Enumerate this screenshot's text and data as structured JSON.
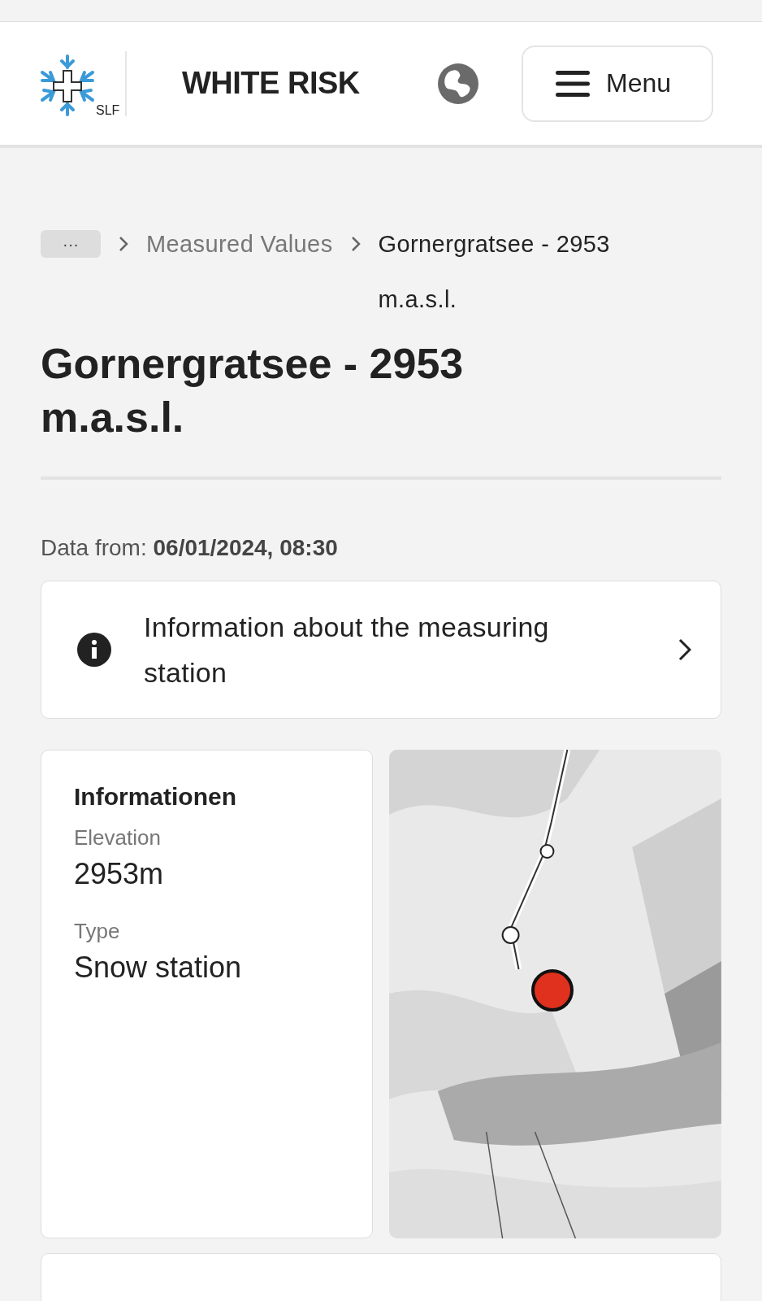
{
  "header": {
    "logo_caption": "SLF",
    "brand": "WHITE RISK",
    "menu_button": "Menu"
  },
  "breadcrumb": {
    "collapsed": "···",
    "items": [
      {
        "label": "Measured Values",
        "current": false
      },
      {
        "label": "Gornergratsee - 2953 m.a.s.l.",
        "current": true
      }
    ]
  },
  "title": "Gornergratsee - 2953 m.a.s.l.",
  "data_from": {
    "label": "Data from: ",
    "value": "06/01/2024, 08:30"
  },
  "info_link": "Information about the measuring station",
  "info_card": {
    "heading": "Informationen",
    "fields": [
      {
        "label": "Elevation",
        "value": "2953m"
      },
      {
        "label": "Type",
        "value": "Snow station"
      }
    ]
  }
}
